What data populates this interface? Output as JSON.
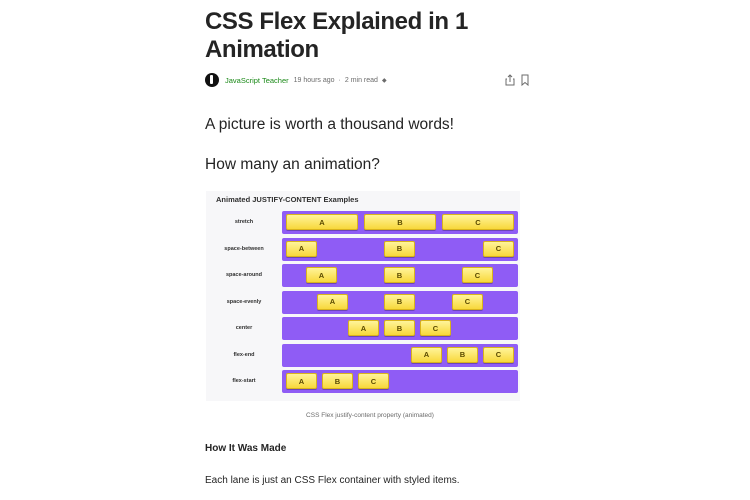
{
  "article": {
    "title_line1": "CSS Flex Explained in 1",
    "title_line2": "Animation",
    "author": "JavaScript Teacher",
    "time_ago": "19 hours ago",
    "read_time": "2 min read",
    "star": "◆",
    "paragraph1": "A picture is worth a thousand words!",
    "paragraph2": "How many an animation?",
    "caption": "CSS Flex justify-content property (animated)",
    "heading": "How It Was Made",
    "paragraph3": "Each lane is just an CSS Flex container with styled items."
  },
  "icons": {
    "share": "share-icon",
    "bookmark": "bookmark-icon"
  },
  "figure": {
    "title": "Animated JUSTIFY-CONTENT Examples",
    "lane_color": "#8f5cf5",
    "item_color": "#f8d83b",
    "lanes": [
      {
        "label": "stretch",
        "items": [
          "A",
          "B",
          "C"
        ]
      },
      {
        "label": "space-between",
        "items": [
          "A",
          "B",
          "C"
        ]
      },
      {
        "label": "space-around",
        "items": [
          "A",
          "B",
          "C"
        ]
      },
      {
        "label": "space-evenly",
        "items": [
          "A",
          "B",
          "C"
        ]
      },
      {
        "label": "center",
        "items": [
          "A",
          "B",
          "C"
        ]
      },
      {
        "label": "flex-end",
        "items": [
          "A",
          "B",
          "C"
        ]
      },
      {
        "label": "flex-start",
        "items": [
          "A",
          "B",
          "C"
        ]
      }
    ]
  }
}
